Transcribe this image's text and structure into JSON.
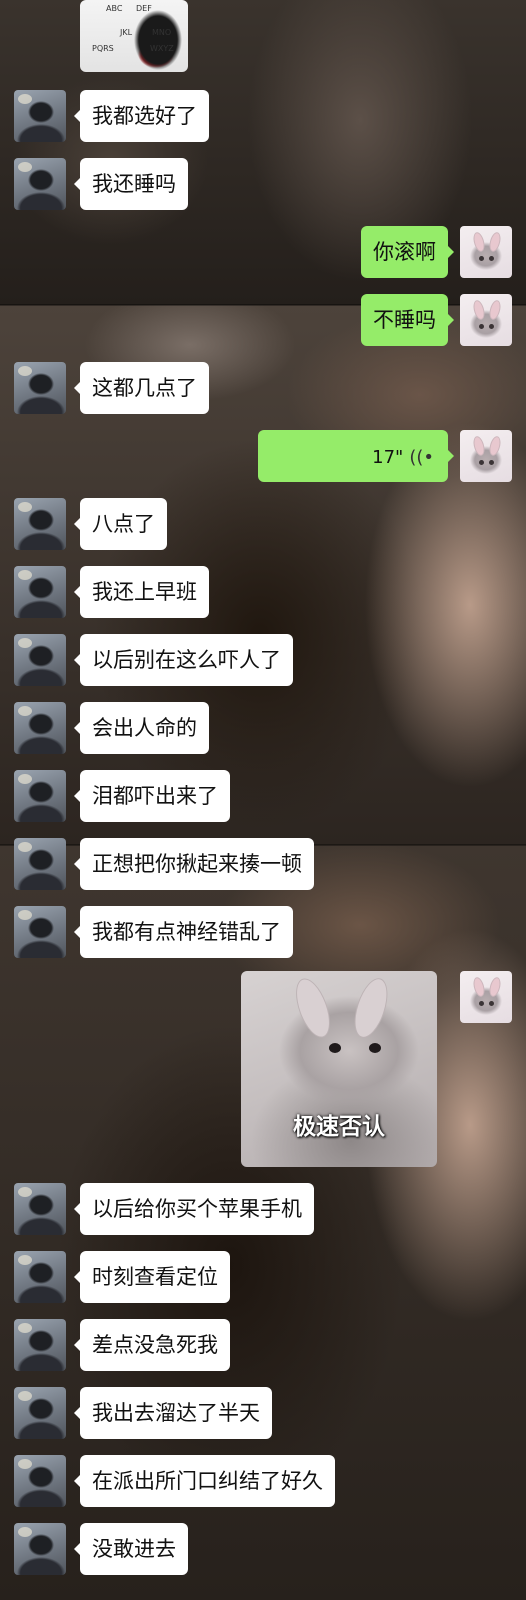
{
  "chat": {
    "image_top": {
      "type": "image",
      "keys": [
        "ABC",
        "DEF",
        "JKL",
        "MNO",
        "PQRS",
        "WXYZ"
      ]
    },
    "messages": [
      {
        "side": "in",
        "text": "我都选好了"
      },
      {
        "side": "in",
        "text": "我还睡吗"
      },
      {
        "side": "out",
        "text": "你滚啊"
      },
      {
        "side": "out",
        "text": "不睡吗"
      },
      {
        "side": "in",
        "text": "这都几点了"
      },
      {
        "side": "out",
        "type": "voice",
        "duration": "17\""
      },
      {
        "side": "in",
        "text": "八点了"
      },
      {
        "side": "in",
        "text": "我还上早班"
      },
      {
        "side": "in",
        "text": "以后别在这么吓人了"
      },
      {
        "side": "in",
        "text": "会出人命的"
      },
      {
        "side": "in",
        "text": "泪都吓出来了"
      },
      {
        "side": "in",
        "text": "正想把你揪起来揍一顿"
      },
      {
        "side": "in",
        "text": "我都有点神经错乱了"
      },
      {
        "side": "out",
        "type": "sticker",
        "caption": "极速否认"
      },
      {
        "side": "in",
        "text": "以后给你买个苹果手机"
      },
      {
        "side": "in",
        "text": "时刻查看定位"
      },
      {
        "side": "in",
        "text": "差点没急死我"
      },
      {
        "side": "in",
        "text": "我出去溜达了半天"
      },
      {
        "side": "in",
        "text": "在派出所门口纠结了好久"
      },
      {
        "side": "in",
        "text": "没敢进去"
      }
    ]
  },
  "colors": {
    "incoming_bubble": "#ffffff",
    "outgoing_bubble": "#95ec69"
  }
}
